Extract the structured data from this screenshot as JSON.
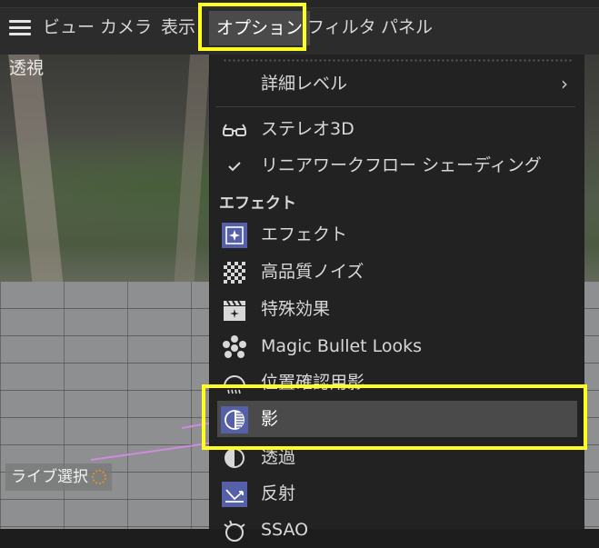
{
  "menubar": {
    "items": [
      "ビュー",
      "カメラ",
      "表示",
      "オプション",
      "フィルタ",
      "パネル"
    ],
    "active": "オプション"
  },
  "viewport": {
    "label": "透視",
    "live_select": "ライブ選択"
  },
  "menu": {
    "detail_level": "詳細レベル",
    "stereo": "ステレオ3D",
    "linear": "リニアワークフロー シェーディング",
    "section_effect": "エフェクト",
    "items": [
      "エフェクト",
      "高品質ノイズ",
      "特殊効果",
      "Magic Bullet Looks",
      "位置確認用影",
      "影",
      "透過",
      "反射",
      "SSAO"
    ],
    "selected": "影"
  },
  "icons": {
    "stereo": "stereo-glasses-icon",
    "linear": "checkmark-icon",
    "effect": "effect-sparkle-icon",
    "noise": "checker-noise-icon",
    "special": "clapper-icon",
    "magic": "molecule-icon",
    "position_shadow": "dome-shadow-icon",
    "shadow": "shadow-sphere-icon",
    "transparency": "half-circle-icon",
    "reflection": "reflection-icon",
    "ssao": "ssao-icon",
    "submenu": "chevron-right-icon"
  },
  "colors": {
    "highlight": "#ffff22",
    "icon_blue": "#5560a8",
    "menu_bg": "#222222",
    "selected_bg": "#4a4a4a"
  }
}
